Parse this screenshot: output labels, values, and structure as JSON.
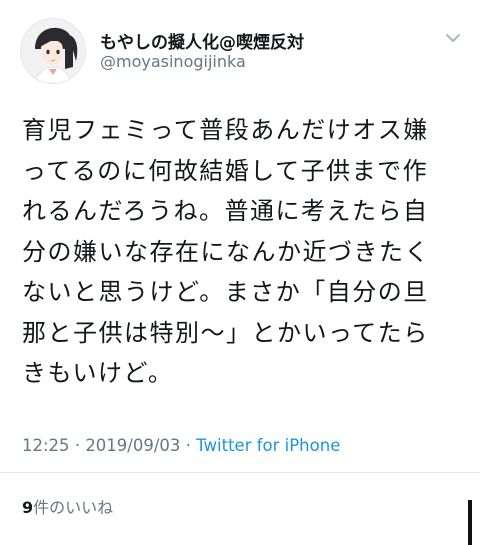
{
  "tweet": {
    "author": {
      "display_name": "もやしの擬人化@喫煙反対",
      "handle": "@moyasinogijinka"
    },
    "text": "育児フェミって普段あんだけオス嫌\nってるのに何故結婚して子供まで作\nれるんだろうね。普通に考えたら自\n分の嫌いな存在になんか近づきたく\nないと思うけど。まさか「自分の旦\n那と子供は特別〜」とかいってたら\nきもいけど。",
    "time": "12:25",
    "separator": " · ",
    "date": "2019/09/03",
    "source": "Twitter for iPhone",
    "likes_count": "9",
    "likes_label": "件のいいね"
  },
  "icons": {
    "avatar": "avatar-illustration",
    "menu": "chevron-down-icon"
  },
  "colors": {
    "text": "#14171a",
    "secondary": "#657786",
    "link": "#1b95e0",
    "divider": "#e1e8ed"
  }
}
